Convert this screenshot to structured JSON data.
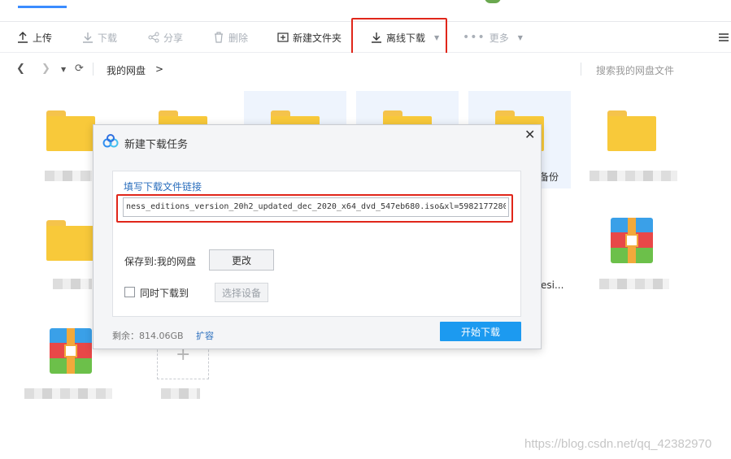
{
  "toolbar": {
    "upload": "上传",
    "download": "下载",
    "share": "分享",
    "delete": "删除",
    "new_folder": "新建文件夹",
    "offline_download": "离线下载",
    "more": "更多"
  },
  "nav": {
    "breadcrumb": "我的网盘",
    "breadcrumb_sep": ">",
    "search_placeholder": "搜索我的网盘文件"
  },
  "grid": {
    "partial_label_1": "备份",
    "partial_label_2": "esi..."
  },
  "dialog": {
    "title": "新建下载任务",
    "link_label": "填写下载文件链接",
    "url_value": "ness_editions_version_20h2_updated_dec_2020_x64_dvd_547eb680.iso&xl=5982177280",
    "save_to_label": "保存到:我的网盘",
    "change_button": "更改",
    "simul_label": "同时下载到",
    "choose_device_button": "选择设备",
    "remaining": "剩余：814.06GB",
    "expand_link": "扩容",
    "start_button": "开始下载"
  },
  "watermark": "https://blog.csdn.net/qq_42382970",
  "colors": {
    "accent": "#1c9af0",
    "highlight": "#e0261a",
    "folder": "#f8c93a"
  }
}
